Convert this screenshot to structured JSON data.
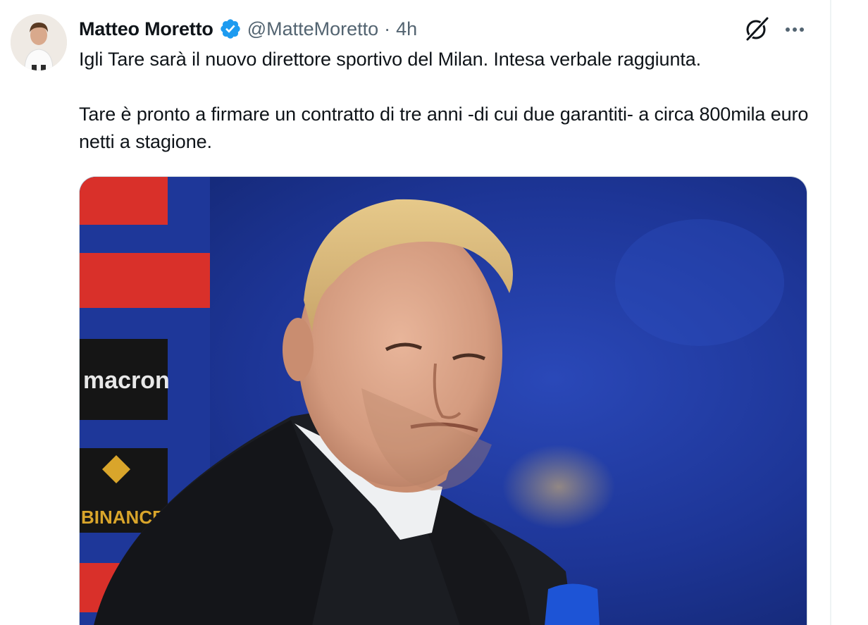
{
  "author": {
    "display_name": "Matteo Moretto",
    "handle": "@MatteMoretto",
    "separator": "·",
    "time": "4h",
    "verified": true,
    "avatar_icon": "avatar-photo"
  },
  "tweet": {
    "text": "Igli Tare sarà il nuovo direttore sportivo del Milan. Intesa verbale raggiunta.\n\nTare è pronto a firmare un contratto di tre anni -di cui due garantiti- a circa 800mila euro netti a stagione."
  },
  "actions": {
    "grok_icon": "grok-icon",
    "more_icon": "more-icon"
  },
  "media": {
    "sponsor_board_text": "macron",
    "sponsor_board_text_2": "BINANCE",
    "colors": {
      "background_blue": "#1f3a9a",
      "board_red": "#d9302a",
      "jacket": "#1b1d22"
    }
  },
  "colors": {
    "text_primary": "#0f1419",
    "text_secondary": "#536471",
    "verified_blue": "#1d9bf0"
  }
}
